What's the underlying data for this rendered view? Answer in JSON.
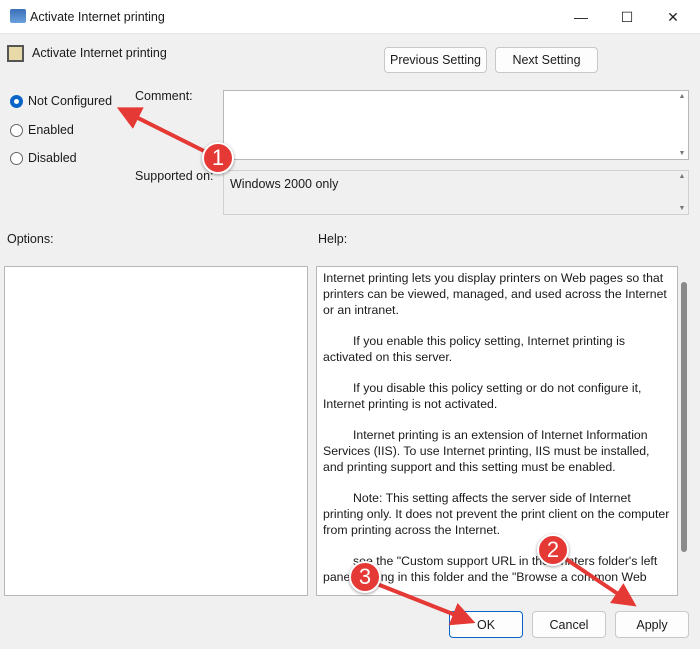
{
  "window": {
    "title": "Activate Internet printing",
    "minimize": "—",
    "maximize": "☐",
    "close": "✕"
  },
  "header": {
    "title": "Activate Internet printing",
    "previous": "Previous Setting",
    "next": "Next Setting"
  },
  "radios": [
    {
      "label": "Not Configured",
      "checked": true
    },
    {
      "label": "Enabled",
      "checked": false
    },
    {
      "label": "Disabled",
      "checked": false
    }
  ],
  "comment_label": "Comment:",
  "comment_value": "",
  "supported_label": "Supported on:",
  "supported_value": "Windows 2000 only",
  "options_label": "Options:",
  "help_label": "Help:",
  "help": [
    "Internet printing lets you display printers on Web pages so that printers can be viewed, managed, and used across the Internet or an intranet.",
    "If you enable this policy setting, Internet printing is activated on this server.",
    "If you disable this policy setting or do not configure it, Internet printing is not activated.",
    "Internet printing is an extension of Internet Information Services (IIS). To use Internet printing, IIS must be installed, and printing support and this setting must be enabled.",
    "Note: This setting affects the server side of Internet printing only. It does not prevent the print client on the computer from printing across the Internet.",
    "see the \"Custom support URL in the Printers folder's left pane\" setting in this folder and the \"Browse a common Web"
  ],
  "buttons": {
    "ok": "OK",
    "cancel": "Cancel",
    "apply": "Apply"
  },
  "annotations": [
    "1",
    "2",
    "3"
  ],
  "colors": {
    "accent": "#0a64c8",
    "annotation": "#e53935"
  }
}
